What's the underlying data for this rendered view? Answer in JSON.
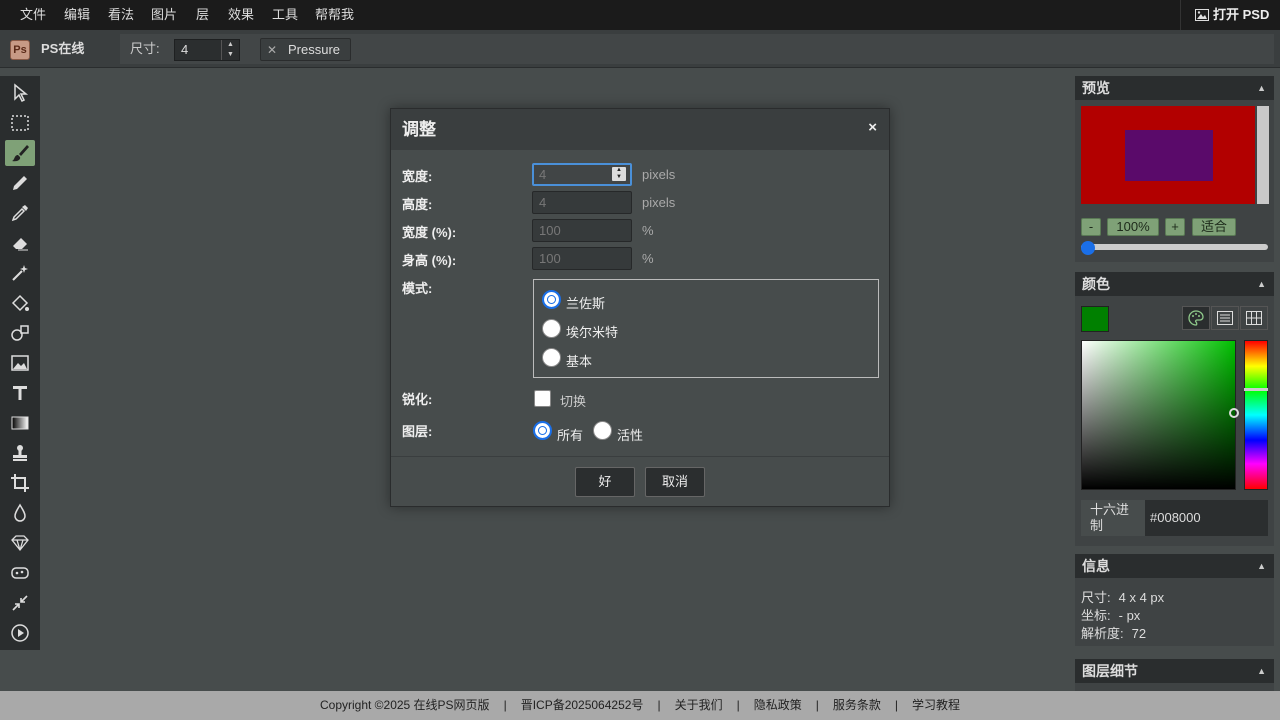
{
  "menu": [
    "文件",
    "编辑",
    "看法",
    "图片",
    "层",
    "效果",
    "工具",
    "帮帮我"
  ],
  "open_psd": "打开 PSD",
  "brand": {
    "logo": "Ps",
    "name": "PS在线"
  },
  "options": {
    "size_label": "尺寸:",
    "size_value": "4",
    "pressure_label": "Pressure"
  },
  "tools": [
    "select-tool",
    "marquee-tool",
    "brush-tool",
    "pencil-tool",
    "eyedropper-tool",
    "eraser-tool",
    "magic-wand-tool",
    "fill-tool",
    "shape-tool",
    "image-tool",
    "text-tool",
    "gradient-tool",
    "stamp-tool",
    "crop-tool",
    "blur-tool",
    "sharpen-tool",
    "smudge-tool",
    "resize-tool",
    "play-tool"
  ],
  "dialog": {
    "title": "调整",
    "close": "×",
    "width_label": "宽度:",
    "width_value": "4",
    "height_label": "高度:",
    "height_value": "4",
    "width_pct_label": "宽度 (%):",
    "width_pct_value": "100",
    "height_pct_label": "身高 (%):",
    "height_pct_value": "100",
    "unit_px": "pixels",
    "unit_pct": "%",
    "mode_label": "模式:",
    "modes": [
      "兰佐斯",
      "埃尔米特",
      "基本"
    ],
    "selected_mode": "兰佐斯",
    "sharpen_label": "锐化:",
    "sharpen_toggle": "切换",
    "sharpen_checked": false,
    "layer_label": "图层:",
    "layer_options": [
      "所有",
      "活性"
    ],
    "selected_layer": "所有",
    "ok": "好",
    "cancel": "取消"
  },
  "preview": {
    "title": "预览",
    "zoom_out": "-",
    "zoom": "100%",
    "zoom_in": "+",
    "fit": "适合"
  },
  "color": {
    "title": "颜色",
    "current": "#008000",
    "hex_label": "十六进制",
    "hex_value": "#008000"
  },
  "info": {
    "title": "信息",
    "size_label": "尺寸:",
    "size_value": "4 x 4 px",
    "coord_label": "坐标:",
    "coord_value": "- px",
    "resolution_label": "解析度:",
    "resolution_value": "72"
  },
  "layer_details": {
    "title": "图层细节"
  },
  "footer": [
    "Copyright ©2025 在线PS网页版",
    "晋ICP备2025064252号",
    "关于我们",
    "隐私政策",
    "服务条款",
    "学习教程"
  ],
  "footer_sep": "|"
}
